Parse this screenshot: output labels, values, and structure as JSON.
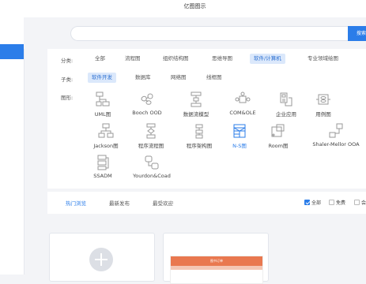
{
  "window": {
    "title": "亿图图示"
  },
  "search": {
    "button_label": "搜索"
  },
  "filters": {
    "category": {
      "label": "分类:",
      "items": [
        "全部",
        "流程图",
        "组织结构图",
        "思维导图",
        "软件/计算机",
        "专业领域绘图"
      ],
      "active": "软件/计算机"
    },
    "subcategory": {
      "label": "子类:",
      "items": [
        "软件开发",
        "数据库",
        "网络图",
        "线框图"
      ],
      "active": "软件开发"
    },
    "shapes": {
      "label": "图形:",
      "items": [
        "UML图",
        "Booch OOD",
        "数据流模型",
        "COM&OLE",
        "企业应用",
        "用例图",
        "Jackson图",
        "程序流程图",
        "程序架构图",
        "N-S图",
        "Room图",
        "Shaler-Mellor OOA",
        "SSADM",
        "Yourdon&Coad"
      ],
      "active": "N-S图"
    }
  },
  "tabs": {
    "items": [
      "热门浏览",
      "最新发布",
      "最受欢迎"
    ],
    "active": "热门浏览"
  },
  "checks": {
    "all": "全部",
    "free": "免费",
    "third": "会"
  },
  "thumb": {
    "title": "图书订单"
  },
  "colors": {
    "accent": "#2b7de9",
    "active_chip_bg": "#dbe8fb",
    "thumb_orange": "#e9784f"
  }
}
